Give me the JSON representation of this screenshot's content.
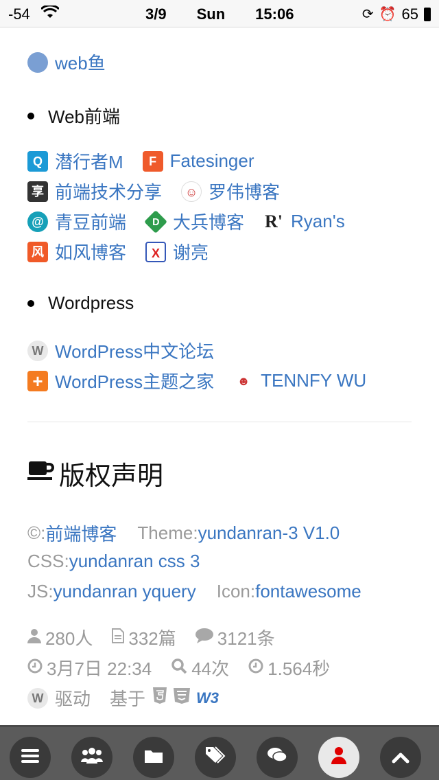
{
  "status_bar": {
    "signal": "-54",
    "apple_icon": "apple-icon",
    "wifi_icon": "wifi-icon",
    "date": "3/9",
    "weekday": "Sun",
    "time": "15:06",
    "battery": "65"
  },
  "links_top": {
    "webyu": "web鱼"
  },
  "section_web": {
    "title": "Web前端",
    "rows": [
      [
        {
          "label": "潜行者M",
          "icon": "Q"
        },
        {
          "label": "Fatesinger",
          "icon": "F"
        }
      ],
      [
        {
          "label": "前端技术分享",
          "icon": "享"
        },
        {
          "label": "罗伟博客",
          "icon": "☺"
        }
      ],
      [
        {
          "label": "青豆前端",
          "icon": "@"
        },
        {
          "label": "大兵博客",
          "icon": "D"
        },
        {
          "label": "Ryan's",
          "icon": "R'"
        }
      ],
      [
        {
          "label": "如风博客",
          "icon": "风"
        },
        {
          "label": "谢亮",
          "icon": "X"
        }
      ]
    ]
  },
  "section_wp": {
    "title": "Wordpress",
    "rows": [
      [
        {
          "label": "WordPress中文论坛",
          "icon": "W"
        }
      ],
      [
        {
          "label": "WordPress主题之家",
          "icon": "+"
        },
        {
          "label": "TENNFY WU",
          "icon": "☻"
        }
      ]
    ]
  },
  "copyright": {
    "heading": "版权声明",
    "line1": {
      "copy_label": "©:",
      "copy_value": "前端博客",
      "theme_label": "Theme:",
      "theme_value": "yundanran-3 V1.0"
    },
    "line2": {
      "css_label": "CSS:",
      "css_value": "yundanran css 3"
    },
    "line3": {
      "js_label": "JS:",
      "js_value": "yundanran yquery",
      "icon_label": "Icon:",
      "icon_value": "fontawesome"
    }
  },
  "stats": {
    "users": "280人",
    "posts": "332篇",
    "comments": "3121条",
    "last_update": "3月7日 22:34",
    "queries": "44次",
    "load_time": "1.564秒",
    "powered": "驱动",
    "based_on": "基于",
    "w3": "W3"
  },
  "bottom_nav": [
    "menu-icon",
    "users-icon",
    "folder-icon",
    "tags-icon",
    "comments-icon",
    "user-icon",
    "chevron-up-icon"
  ],
  "colors": {
    "link": "#3a76c1",
    "muted": "#9a9a9a",
    "nav_bg": "#5b5b5b",
    "active": "#e00000"
  }
}
